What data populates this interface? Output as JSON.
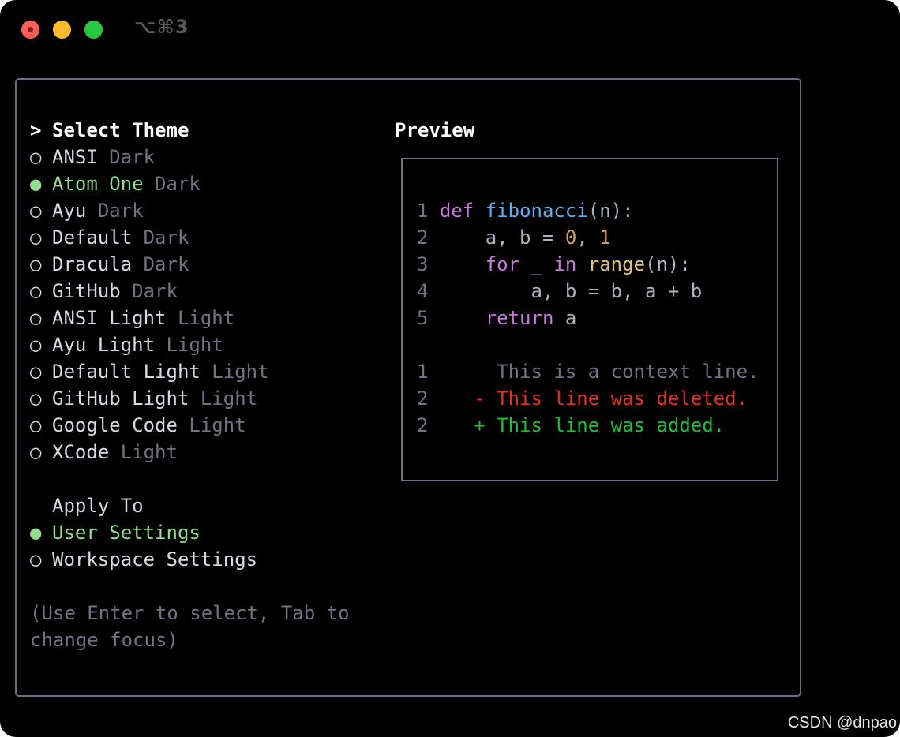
{
  "window": {
    "title": "⌥⌘3"
  },
  "theme_list": {
    "heading_marker": ">",
    "heading": "Select Theme",
    "items": [
      {
        "name": "ANSI",
        "variant": "Dark",
        "selected": false
      },
      {
        "name": "Atom One",
        "variant": "Dark",
        "selected": true
      },
      {
        "name": "Ayu",
        "variant": "Dark",
        "selected": false
      },
      {
        "name": "Default",
        "variant": "Dark",
        "selected": false
      },
      {
        "name": "Dracula",
        "variant": "Dark",
        "selected": false
      },
      {
        "name": "GitHub",
        "variant": "Dark",
        "selected": false
      },
      {
        "name": "ANSI Light",
        "variant": "Light",
        "selected": false
      },
      {
        "name": "Ayu Light",
        "variant": "Light",
        "selected": false
      },
      {
        "name": "Default Light",
        "variant": "Light",
        "selected": false
      },
      {
        "name": "GitHub Light",
        "variant": "Light",
        "selected": false
      },
      {
        "name": "Google Code",
        "variant": "Light",
        "selected": false
      },
      {
        "name": "XCode",
        "variant": "Light",
        "selected": false
      }
    ]
  },
  "apply_to": {
    "heading": "Apply To",
    "items": [
      {
        "label": "User Settings",
        "selected": true
      },
      {
        "label": "Workspace Settings",
        "selected": false
      }
    ]
  },
  "hint": {
    "line1": "(Use Enter to select, Tab to",
    "line2": "change focus)"
  },
  "markers": {
    "selected": "●",
    "unselected": "○"
  },
  "preview": {
    "title": "Preview",
    "code": {
      "l1": {
        "n": "1",
        "kw": "def",
        "fn": "fibonacci",
        "rest": "(n):"
      },
      "l2": {
        "n": "2",
        "a": "    a, b = ",
        "n0": "0",
        "sep": ", ",
        "n1": "1"
      },
      "l3": {
        "n": "3",
        "indent": "    ",
        "kw1": "for",
        "mid": " _ ",
        "kw2": "in",
        "sp": " ",
        "bi": "range",
        "rest": "(n):"
      },
      "l4": {
        "n": "4",
        "text": "        a, b = b, a + b"
      },
      "l5": {
        "n": "5",
        "indent": "    ",
        "kw": "return",
        "rest": " a"
      }
    },
    "diff": {
      "context": {
        "n": "1",
        "text": "This is a context line."
      },
      "deleted": {
        "n": "2",
        "text": "- This line was deleted."
      },
      "added": {
        "n": "2",
        "text": "+ This line was added."
      }
    }
  },
  "watermark": "CSDN @dnpao",
  "colors": {
    "selected": "#93dd8e",
    "dim": "#717385",
    "keyword": "#c678dd",
    "function": "#61afef",
    "number": "#d19a66",
    "builtin": "#e5c07b",
    "deleted": "#e0321e",
    "added": "#22bd37"
  }
}
